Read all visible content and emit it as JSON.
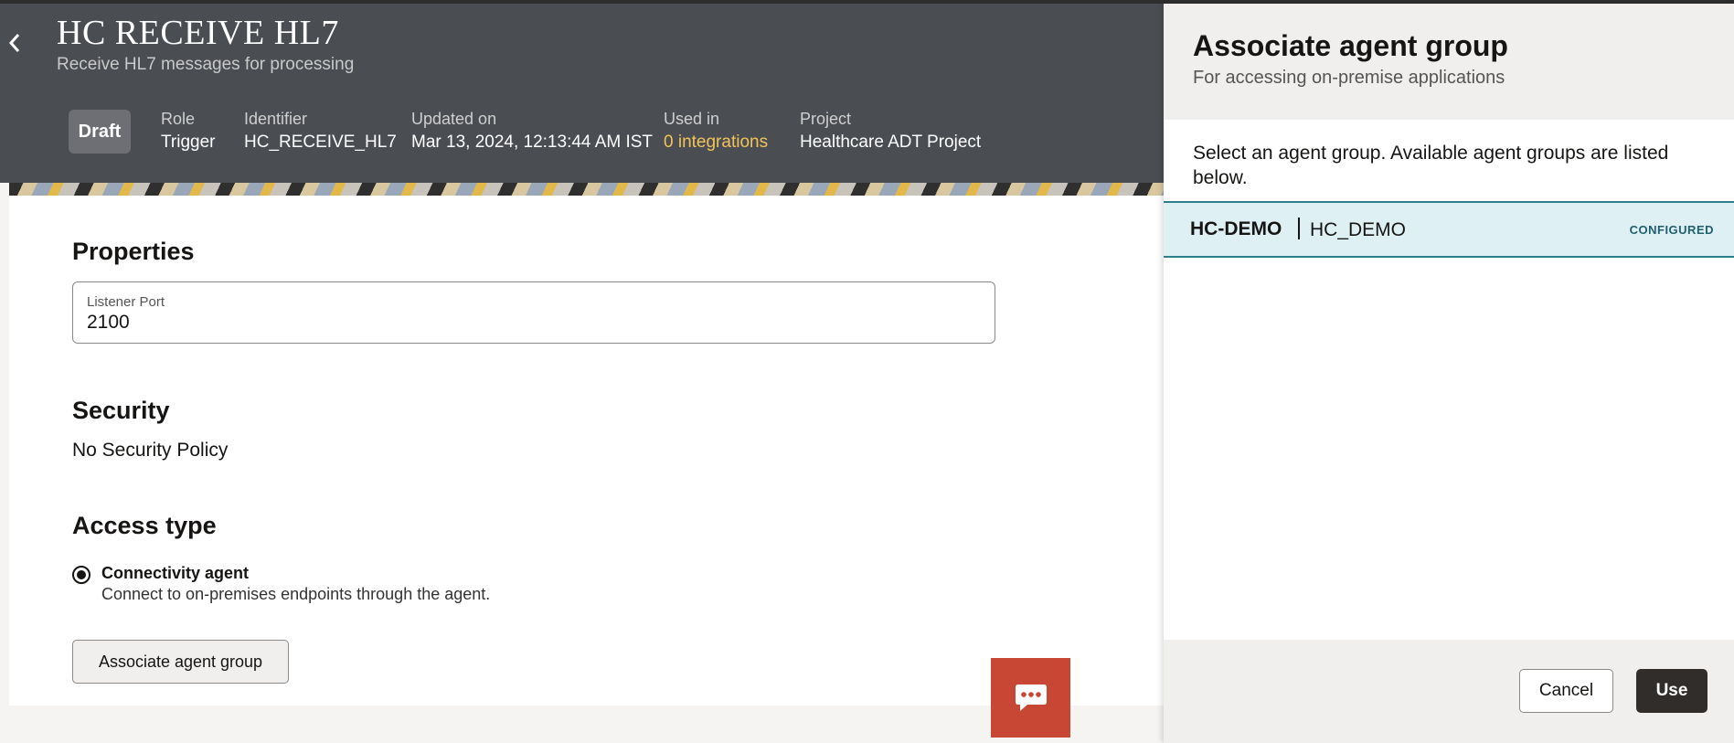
{
  "header": {
    "title": "HC RECEIVE HL7",
    "subtitle": "Receive HL7 messages for processing",
    "badge": "Draft",
    "meta": [
      {
        "label": "Role",
        "value": "Trigger"
      },
      {
        "label": "Identifier",
        "value": "HC_RECEIVE_HL7"
      },
      {
        "label": "Updated on",
        "value": "Mar 13, 2024, 12:13:44 AM IST"
      },
      {
        "label": "Used in",
        "value": "0 integrations"
      },
      {
        "label": "Project",
        "value": "Healthcare ADT Project"
      }
    ]
  },
  "properties": {
    "title": "Properties",
    "field_label": "Listener Port",
    "field_value": "2100"
  },
  "security": {
    "title": "Security",
    "value": "No Security Policy"
  },
  "access": {
    "title": "Access type",
    "option_label": "Connectivity agent",
    "option_desc": "Connect to on-premises endpoints through the agent.",
    "button": "Associate agent group"
  },
  "drawer": {
    "title": "Associate agent group",
    "subtitle": "For accessing on-premise applications",
    "instruction": "Select an agent group. Available agent groups are listed below.",
    "groups": [
      {
        "name": "HC-DEMO",
        "id": "HC_DEMO",
        "status": "CONFIGURED"
      }
    ],
    "cancel": "Cancel",
    "use": "Use"
  },
  "icons": {
    "back": "chevron-left-icon",
    "chat": "chat-bubble-icon"
  },
  "colors": {
    "header_bg": "#4a4d52",
    "link": "#f2c35a",
    "selected_row": "#dff0f5",
    "chat": "#c74634",
    "primary_button": "#312d2a"
  }
}
